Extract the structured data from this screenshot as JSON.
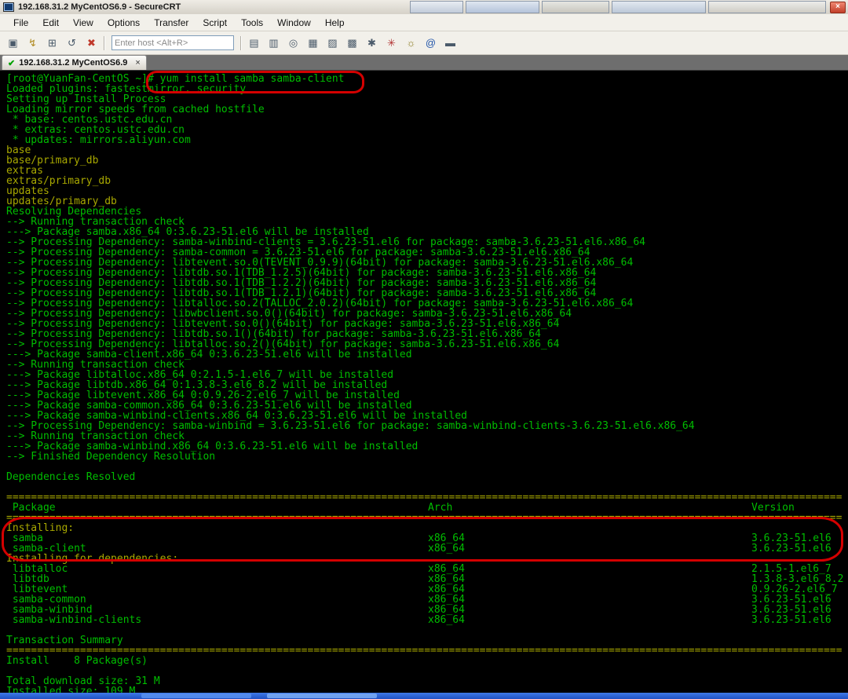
{
  "window": {
    "title": "192.168.31.2 MyCentOS6.9 - SecureCRT",
    "close_glyph": "×"
  },
  "menu": {
    "items": [
      "File",
      "Edit",
      "View",
      "Options",
      "Transfer",
      "Script",
      "Tools",
      "Window",
      "Help"
    ]
  },
  "toolbar": {
    "host_placeholder": "Enter host <Alt+R>",
    "host_value": "",
    "left_icons": [
      {
        "name": "connect-icon",
        "glyph": "▣"
      },
      {
        "name": "quick-connect-icon",
        "glyph": "↯",
        "color": "#b08a20"
      },
      {
        "name": "connect-in-tab-icon",
        "glyph": "⊞"
      },
      {
        "name": "reconnect-icon",
        "glyph": "↺"
      },
      {
        "name": "disconnect-icon",
        "glyph": "✖",
        "color": "#c0392b"
      }
    ],
    "right_icons": [
      {
        "name": "copy-icon",
        "glyph": "▤"
      },
      {
        "name": "paste-icon",
        "glyph": "▥"
      },
      {
        "name": "find-icon",
        "glyph": "◎"
      },
      {
        "name": "print-icon",
        "glyph": "▦"
      },
      {
        "name": "print-preview-icon",
        "glyph": "▨"
      },
      {
        "name": "print-setup-icon",
        "glyph": "▩"
      },
      {
        "name": "session-options-icon",
        "glyph": "✱"
      },
      {
        "name": "run-script-icon",
        "glyph": "✳",
        "color": "#b03030"
      },
      {
        "name": "light-bulb-icon",
        "glyph": "☼",
        "color": "#8a7a20"
      },
      {
        "name": "web-help-icon",
        "glyph": "@",
        "color": "#2255aa"
      },
      {
        "name": "keymap-icon",
        "glyph": "▬"
      }
    ]
  },
  "session_tab": {
    "status_glyph": "✔",
    "label": "192.168.31.2 MyCentOS6.9",
    "close_glyph": "×"
  },
  "terminal": {
    "colors": {
      "background": "#000000",
      "green": "#00bd00",
      "yellow": "#a8a800",
      "annotation_red": "#d40000"
    },
    "separator_char": "=",
    "separator_length": 136,
    "table_columns": [
      "Package",
      "Arch",
      "Version"
    ],
    "lines": [
      {
        "t": "[root@YuanFan-CentOS ~]# yum install samba samba-client"
      },
      {
        "t": "Loaded plugins: fastestmirror, security"
      },
      {
        "t": "Setting up Install Process"
      },
      {
        "t": "Loading mirror speeds from cached hostfile"
      },
      {
        "t": " * base: centos.ustc.edu.cn"
      },
      {
        "t": " * extras: centos.ustc.edu.cn"
      },
      {
        "t": " * updates: mirrors.aliyun.com"
      },
      {
        "t": "base",
        "c": "y"
      },
      {
        "t": "base/primary_db",
        "c": "y"
      },
      {
        "t": "extras",
        "c": "y"
      },
      {
        "t": "extras/primary_db",
        "c": "y"
      },
      {
        "t": "updates",
        "c": "y"
      },
      {
        "t": "updates/primary_db",
        "c": "y"
      },
      {
        "t": "Resolving Dependencies"
      },
      {
        "t": "--> Running transaction check"
      },
      {
        "t": "---> Package samba.x86_64 0:3.6.23-51.el6 will be installed"
      },
      {
        "t": "--> Processing Dependency: samba-winbind-clients = 3.6.23-51.el6 for package: samba-3.6.23-51.el6.x86_64"
      },
      {
        "t": "--> Processing Dependency: samba-common = 3.6.23-51.el6 for package: samba-3.6.23-51.el6.x86_64"
      },
      {
        "t": "--> Processing Dependency: libtevent.so.0(TEVENT_0.9.9)(64bit) for package: samba-3.6.23-51.el6.x86_64"
      },
      {
        "t": "--> Processing Dependency: libtdb.so.1(TDB_1.2.5)(64bit) for package: samba-3.6.23-51.el6.x86_64"
      },
      {
        "t": "--> Processing Dependency: libtdb.so.1(TDB_1.2.2)(64bit) for package: samba-3.6.23-51.el6.x86_64"
      },
      {
        "t": "--> Processing Dependency: libtdb.so.1(TDB_1.2.1)(64bit) for package: samba-3.6.23-51.el6.x86_64"
      },
      {
        "t": "--> Processing Dependency: libtalloc.so.2(TALLOC_2.0.2)(64bit) for package: samba-3.6.23-51.el6.x86_64"
      },
      {
        "t": "--> Processing Dependency: libwbclient.so.0()(64bit) for package: samba-3.6.23-51.el6.x86_64"
      },
      {
        "t": "--> Processing Dependency: libtevent.so.0()(64bit) for package: samba-3.6.23-51.el6.x86_64"
      },
      {
        "t": "--> Processing Dependency: libtdb.so.1()(64bit) for package: samba-3.6.23-51.el6.x86_64"
      },
      {
        "t": "--> Processing Dependency: libtalloc.so.2()(64bit) for package: samba-3.6.23-51.el6.x86_64"
      },
      {
        "t": "---> Package samba-client.x86_64 0:3.6.23-51.el6 will be installed"
      },
      {
        "t": "--> Running transaction check"
      },
      {
        "t": "---> Package libtalloc.x86_64 0:2.1.5-1.el6_7 will be installed"
      },
      {
        "t": "---> Package libtdb.x86_64 0:1.3.8-3.el6_8.2 will be installed"
      },
      {
        "t": "---> Package libtevent.x86_64 0:0.9.26-2.el6_7 will be installed"
      },
      {
        "t": "---> Package samba-common.x86_64 0:3.6.23-51.el6 will be installed"
      },
      {
        "t": "---> Package samba-winbind-clients.x86_64 0:3.6.23-51.el6 will be installed"
      },
      {
        "t": "--> Processing Dependency: samba-winbind = 3.6.23-51.el6 for package: samba-winbind-clients-3.6.23-51.el6.x86_64"
      },
      {
        "t": "--> Running transaction check"
      },
      {
        "t": "---> Package samba-winbind.x86_64 0:3.6.23-51.el6 will be installed"
      },
      {
        "t": "--> Finished Dependency Resolution"
      },
      {
        "t": ""
      },
      {
        "t": "Dependencies Resolved"
      },
      {
        "t": ""
      },
      {
        "sep": true
      },
      {
        "cols": [
          " Package",
          "Arch",
          "Version"
        ]
      },
      {
        "sep": true
      },
      {
        "t": "Installing:",
        "c": "y"
      },
      {
        "cols": [
          " samba",
          "x86_64",
          "3.6.23-51.el6"
        ]
      },
      {
        "cols": [
          " samba-client",
          "x86_64",
          "3.6.23-51.el6"
        ]
      },
      {
        "t": "Installing for dependencies:",
        "c": "y"
      },
      {
        "cols": [
          " libtalloc",
          "x86_64",
          "2.1.5-1.el6_7"
        ]
      },
      {
        "cols": [
          " libtdb",
          "x86_64",
          "1.3.8-3.el6_8.2"
        ]
      },
      {
        "cols": [
          " libtevent",
          "x86_64",
          "0.9.26-2.el6_7"
        ]
      },
      {
        "cols": [
          " samba-common",
          "x86_64",
          "3.6.23-51.el6"
        ]
      },
      {
        "cols": [
          " samba-winbind",
          "x86_64",
          "3.6.23-51.el6"
        ]
      },
      {
        "cols": [
          " samba-winbind-clients",
          "x86_64",
          "3.6.23-51.el6"
        ]
      },
      {
        "t": ""
      },
      {
        "t": "Transaction Summary"
      },
      {
        "sep": true
      },
      {
        "t": "Install    8 Package(s)"
      },
      {
        "t": ""
      },
      {
        "t": "Total download size: 31 M"
      },
      {
        "t": "Installed size: 109 M"
      }
    ]
  },
  "annotations": [
    {
      "name": "command-highlight",
      "around": "yum install samba samba-client"
    },
    {
      "name": "installing-highlight",
      "around": "Installing: samba, samba-client"
    }
  ]
}
